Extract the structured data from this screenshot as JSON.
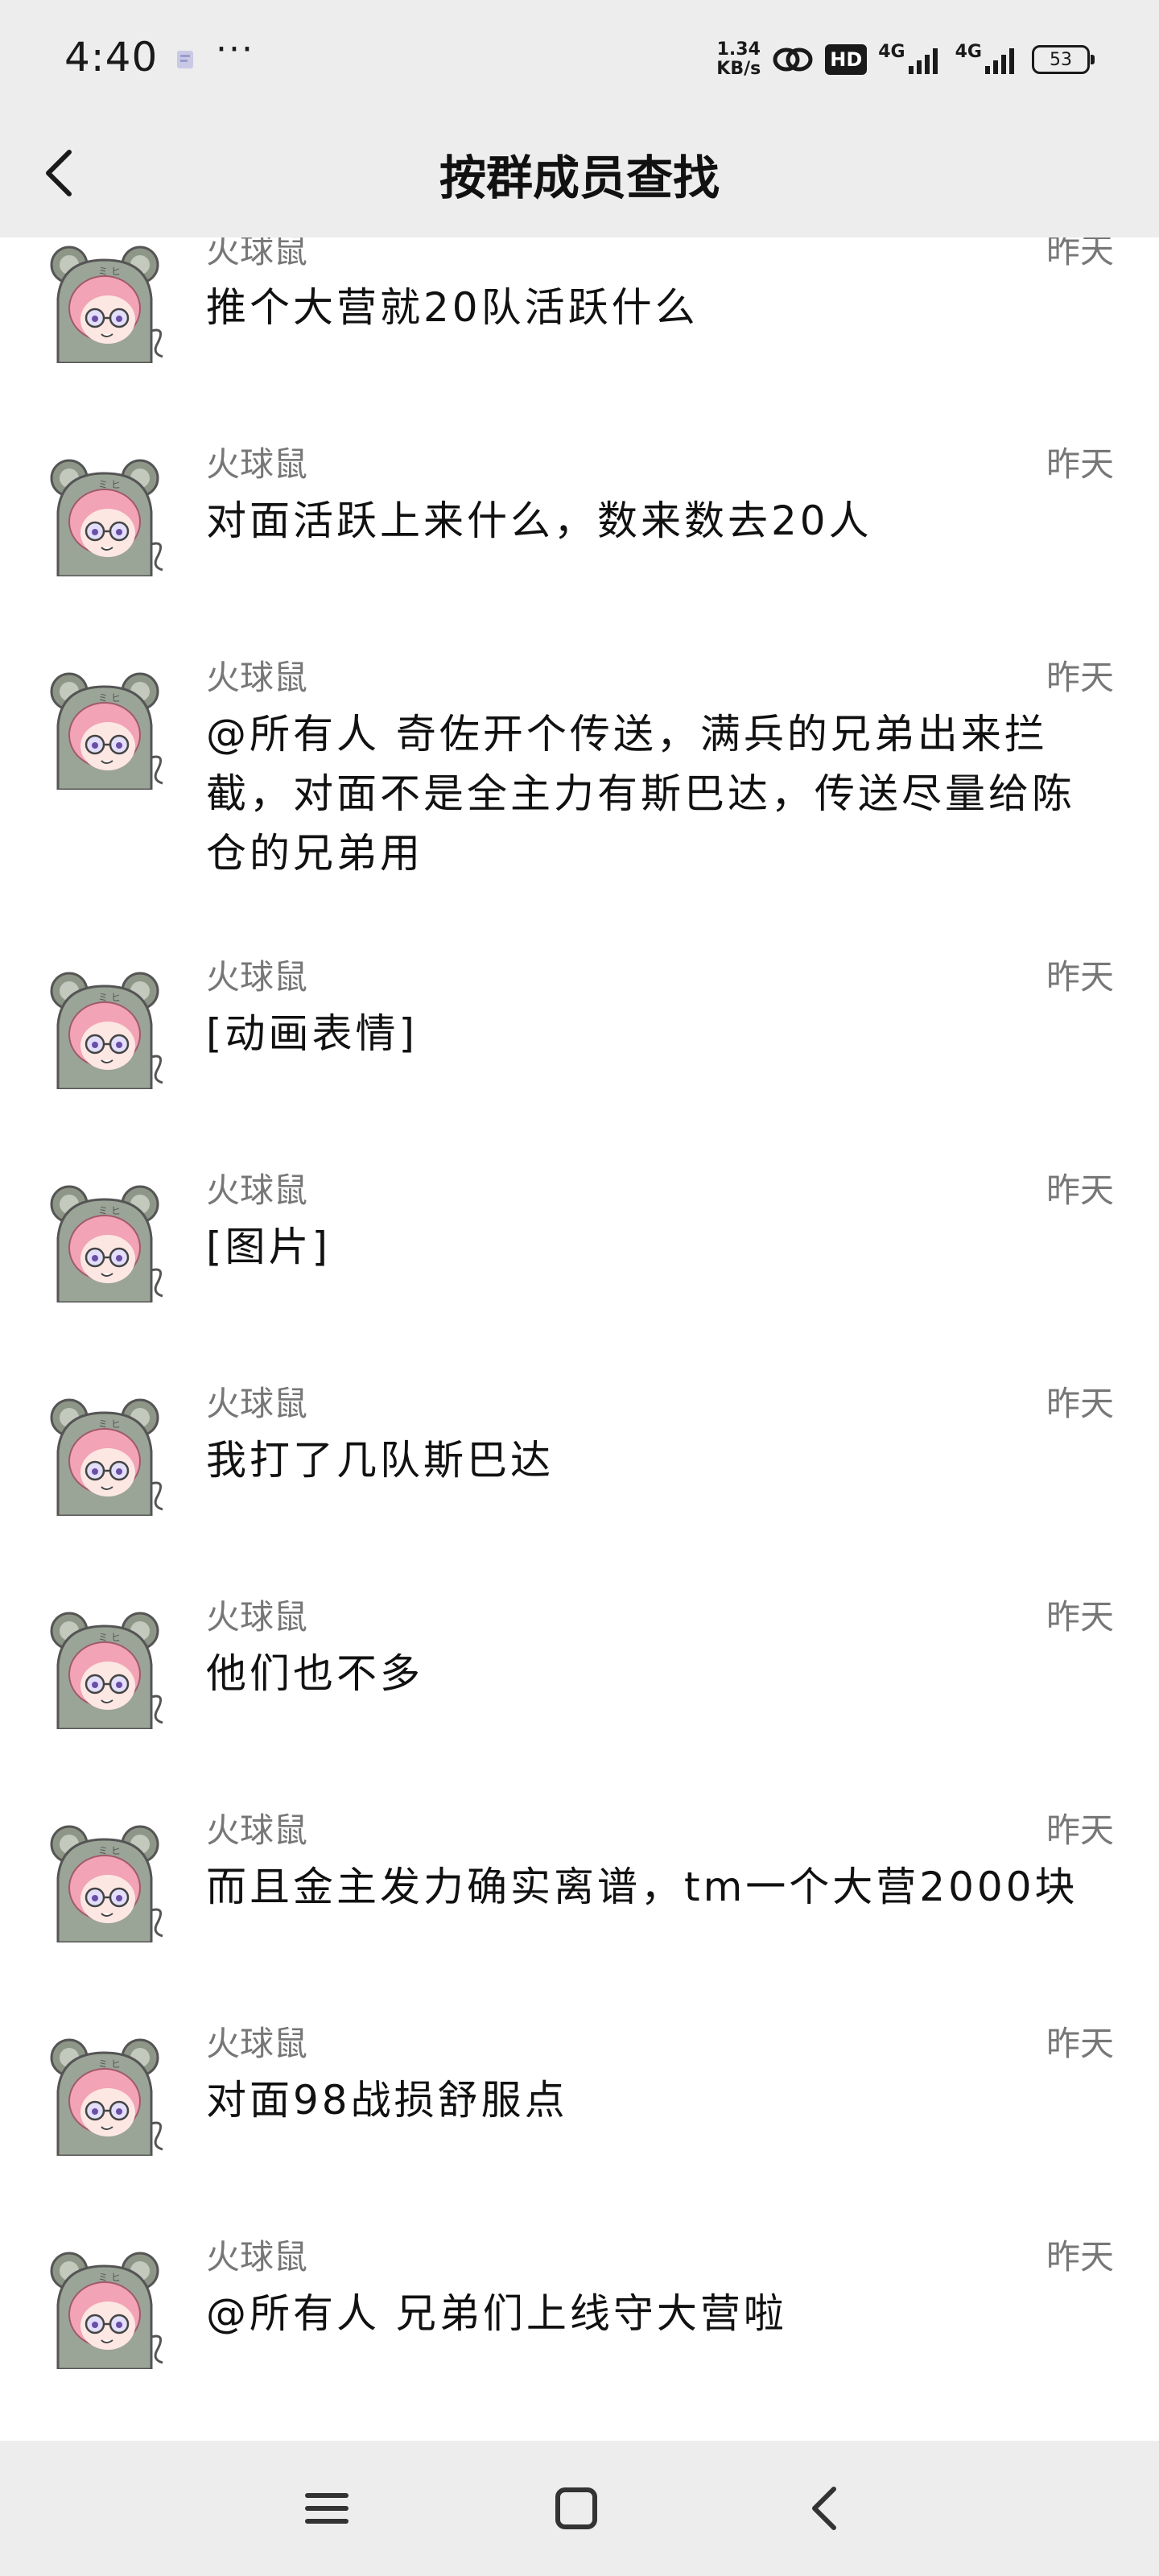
{
  "status_bar": {
    "time": "4:40",
    "more": "···",
    "speed_value": "1.34",
    "speed_unit": "KB/s",
    "hd_label": "HD",
    "network1": "4G",
    "network2": "4G",
    "battery": "53",
    "icons": [
      "notification-icon",
      "link-icon",
      "hd-icon",
      "signal-icon",
      "signal-icon",
      "battery-icon"
    ]
  },
  "header": {
    "title": "按群成员查找",
    "back_icon": "chevron-left-icon"
  },
  "messages": [
    {
      "name": "火球鼠",
      "time": "昨天",
      "text": "推个大营就20队活跃什么"
    },
    {
      "name": "火球鼠",
      "time": "昨天",
      "text": "对面活跃上来什么，数来数去20人"
    },
    {
      "name": "火球鼠",
      "time": "昨天",
      "text": "@所有人 奇佐开个传送，满兵的兄弟出来拦截，对面不是全主力有斯巴达，传送尽量给陈仓的兄弟用"
    },
    {
      "name": "火球鼠",
      "time": "昨天",
      "text": "[动画表情]"
    },
    {
      "name": "火球鼠",
      "time": "昨天",
      "text": "[图片]"
    },
    {
      "name": "火球鼠",
      "time": "昨天",
      "text": "我打了几队斯巴达"
    },
    {
      "name": "火球鼠",
      "time": "昨天",
      "text": "他们也不多"
    },
    {
      "name": "火球鼠",
      "time": "昨天",
      "text": "而且金主发力确实离谱，tm一个大营2000块"
    },
    {
      "name": "火球鼠",
      "time": "昨天",
      "text": "对面98战损舒服点"
    },
    {
      "name": "火球鼠",
      "time": "昨天",
      "text": "@所有人 兄弟们上线守大营啦"
    }
  ],
  "nav_bar": {
    "icons": [
      "menu-icon",
      "home-icon",
      "back-icon"
    ]
  },
  "colors": {
    "bar_background": "#ededed",
    "meta_text": "#777777",
    "message_text": "#111111"
  }
}
